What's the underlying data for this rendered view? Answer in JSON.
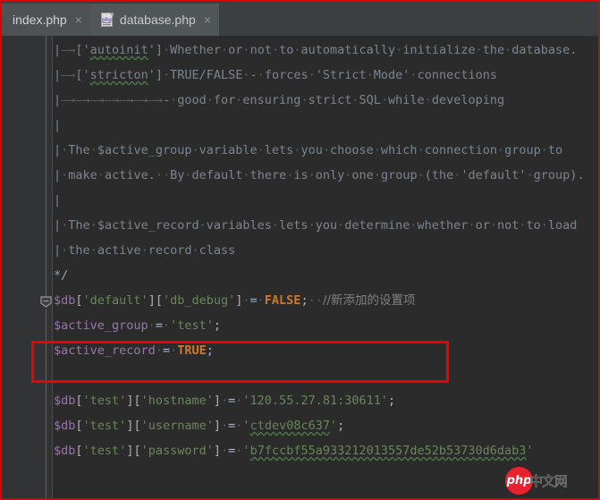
{
  "window": {
    "annotation_box_color": "#f00000"
  },
  "tabs": [
    {
      "label": "index.php",
      "active": false,
      "close": "×",
      "icon": "php-file-icon"
    },
    {
      "label": "database.php",
      "active": true,
      "close": "×",
      "icon": "php-file-icon"
    }
  ],
  "editor": {
    "theme_background": "#2b2b2b",
    "gutter_background": "#313335",
    "fold_marker": "collapse-comment-block",
    "lines": [
      {
        "id": "l1",
        "tokens": [
          {
            "t": "|",
            "c": "cmt"
          },
          {
            "t": "—→",
            "c": "arrow"
          },
          {
            "t": "['",
            "c": "cmt"
          },
          {
            "t": "autoinit",
            "c": "cmt spell"
          },
          {
            "t": "']",
            "c": "cmt"
          },
          {
            "t": "·",
            "c": "ws"
          },
          {
            "t": "Whether",
            "c": "cmt"
          },
          {
            "t": "·",
            "c": "ws"
          },
          {
            "t": "or",
            "c": "cmt"
          },
          {
            "t": "·",
            "c": "ws"
          },
          {
            "t": "not",
            "c": "cmt"
          },
          {
            "t": "·",
            "c": "ws"
          },
          {
            "t": "to",
            "c": "cmt"
          },
          {
            "t": "·",
            "c": "ws"
          },
          {
            "t": "automatically",
            "c": "cmt"
          },
          {
            "t": "·",
            "c": "ws"
          },
          {
            "t": "initialize",
            "c": "cmt"
          },
          {
            "t": "·",
            "c": "ws"
          },
          {
            "t": "the",
            "c": "cmt"
          },
          {
            "t": "·",
            "c": "ws"
          },
          {
            "t": "database.",
            "c": "cmt"
          }
        ]
      },
      {
        "id": "l2",
        "tokens": [
          {
            "t": "|",
            "c": "cmt"
          },
          {
            "t": "—→",
            "c": "arrow"
          },
          {
            "t": "['",
            "c": "cmt"
          },
          {
            "t": "stricton",
            "c": "cmt spell"
          },
          {
            "t": "']",
            "c": "cmt"
          },
          {
            "t": "·",
            "c": "ws"
          },
          {
            "t": "TRUE/FALSE",
            "c": "cmt"
          },
          {
            "t": "·",
            "c": "ws"
          },
          {
            "t": "-",
            "c": "cmt"
          },
          {
            "t": "·",
            "c": "ws"
          },
          {
            "t": "forces",
            "c": "cmt"
          },
          {
            "t": "·",
            "c": "ws"
          },
          {
            "t": "'Strict",
            "c": "cmt"
          },
          {
            "t": "·",
            "c": "ws"
          },
          {
            "t": "Mode'",
            "c": "cmt"
          },
          {
            "t": "·",
            "c": "ws"
          },
          {
            "t": "connections",
            "c": "cmt"
          }
        ]
      },
      {
        "id": "l3",
        "tokens": [
          {
            "t": "|",
            "c": "cmt"
          },
          {
            "t": "—→—→—→—→—→—→—→",
            "c": "arrow"
          },
          {
            "t": "-",
            "c": "cmt"
          },
          {
            "t": "·",
            "c": "ws"
          },
          {
            "t": "good",
            "c": "cmt"
          },
          {
            "t": "·",
            "c": "ws"
          },
          {
            "t": "for",
            "c": "cmt"
          },
          {
            "t": "·",
            "c": "ws"
          },
          {
            "t": "ensuring",
            "c": "cmt"
          },
          {
            "t": "·",
            "c": "ws"
          },
          {
            "t": "strict",
            "c": "cmt"
          },
          {
            "t": "·",
            "c": "ws"
          },
          {
            "t": "SQL",
            "c": "cmt"
          },
          {
            "t": "·",
            "c": "ws"
          },
          {
            "t": "while",
            "c": "cmt"
          },
          {
            "t": "·",
            "c": "ws"
          },
          {
            "t": "developing",
            "c": "cmt"
          }
        ]
      },
      {
        "id": "l4",
        "tokens": [
          {
            "t": "|",
            "c": "cmt"
          }
        ]
      },
      {
        "id": "l5",
        "tokens": [
          {
            "t": "|",
            "c": "cmt"
          },
          {
            "t": "·",
            "c": "ws"
          },
          {
            "t": "The",
            "c": "cmt"
          },
          {
            "t": "·",
            "c": "ws"
          },
          {
            "t": "$active_group",
            "c": "cmt"
          },
          {
            "t": "·",
            "c": "ws"
          },
          {
            "t": "variable",
            "c": "cmt"
          },
          {
            "t": "·",
            "c": "ws"
          },
          {
            "t": "lets",
            "c": "cmt"
          },
          {
            "t": "·",
            "c": "ws"
          },
          {
            "t": "you",
            "c": "cmt"
          },
          {
            "t": "·",
            "c": "ws"
          },
          {
            "t": "choose",
            "c": "cmt"
          },
          {
            "t": "·",
            "c": "ws"
          },
          {
            "t": "which",
            "c": "cmt"
          },
          {
            "t": "·",
            "c": "ws"
          },
          {
            "t": "connection",
            "c": "cmt"
          },
          {
            "t": "·",
            "c": "ws"
          },
          {
            "t": "group",
            "c": "cmt"
          },
          {
            "t": "·",
            "c": "ws"
          },
          {
            "t": "to",
            "c": "cmt"
          }
        ]
      },
      {
        "id": "l6",
        "tokens": [
          {
            "t": "|",
            "c": "cmt"
          },
          {
            "t": "·",
            "c": "ws"
          },
          {
            "t": "make",
            "c": "cmt"
          },
          {
            "t": "·",
            "c": "ws"
          },
          {
            "t": "active.",
            "c": "cmt"
          },
          {
            "t": "··",
            "c": "ws"
          },
          {
            "t": "By",
            "c": "cmt"
          },
          {
            "t": "·",
            "c": "ws"
          },
          {
            "t": "default",
            "c": "cmt"
          },
          {
            "t": "·",
            "c": "ws"
          },
          {
            "t": "there",
            "c": "cmt"
          },
          {
            "t": "·",
            "c": "ws"
          },
          {
            "t": "is",
            "c": "cmt"
          },
          {
            "t": "·",
            "c": "ws"
          },
          {
            "t": "only",
            "c": "cmt"
          },
          {
            "t": "·",
            "c": "ws"
          },
          {
            "t": "one",
            "c": "cmt"
          },
          {
            "t": "·",
            "c": "ws"
          },
          {
            "t": "group",
            "c": "cmt"
          },
          {
            "t": "·",
            "c": "ws"
          },
          {
            "t": "(the",
            "c": "cmt"
          },
          {
            "t": "·",
            "c": "ws"
          },
          {
            "t": "'default'",
            "c": "cmt"
          },
          {
            "t": "·",
            "c": "ws"
          },
          {
            "t": "group).",
            "c": "cmt"
          }
        ]
      },
      {
        "id": "l7",
        "tokens": [
          {
            "t": "|",
            "c": "cmt"
          }
        ]
      },
      {
        "id": "l8",
        "tokens": [
          {
            "t": "|",
            "c": "cmt"
          },
          {
            "t": "·",
            "c": "ws"
          },
          {
            "t": "The",
            "c": "cmt"
          },
          {
            "t": "·",
            "c": "ws"
          },
          {
            "t": "$active_record",
            "c": "cmt"
          },
          {
            "t": "·",
            "c": "ws"
          },
          {
            "t": "variables",
            "c": "cmt"
          },
          {
            "t": "·",
            "c": "ws"
          },
          {
            "t": "lets",
            "c": "cmt"
          },
          {
            "t": "·",
            "c": "ws"
          },
          {
            "t": "you",
            "c": "cmt"
          },
          {
            "t": "·",
            "c": "ws"
          },
          {
            "t": "determine",
            "c": "cmt"
          },
          {
            "t": "·",
            "c": "ws"
          },
          {
            "t": "whether",
            "c": "cmt"
          },
          {
            "t": "·",
            "c": "ws"
          },
          {
            "t": "or",
            "c": "cmt"
          },
          {
            "t": "·",
            "c": "ws"
          },
          {
            "t": "not",
            "c": "cmt"
          },
          {
            "t": "·",
            "c": "ws"
          },
          {
            "t": "to",
            "c": "cmt"
          },
          {
            "t": "·",
            "c": "ws"
          },
          {
            "t": "load",
            "c": "cmt"
          }
        ]
      },
      {
        "id": "l9",
        "tokens": [
          {
            "t": "|",
            "c": "cmt"
          },
          {
            "t": "·",
            "c": "ws"
          },
          {
            "t": "the",
            "c": "cmt"
          },
          {
            "t": "·",
            "c": "ws"
          },
          {
            "t": "active",
            "c": "cmt"
          },
          {
            "t": "·",
            "c": "ws"
          },
          {
            "t": "record",
            "c": "cmt"
          },
          {
            "t": "·",
            "c": "ws"
          },
          {
            "t": "class",
            "c": "cmt"
          }
        ]
      },
      {
        "id": "l10",
        "tokens": [
          {
            "t": "*/",
            "c": "cmt-b"
          }
        ]
      },
      {
        "id": "l11",
        "tokens": [
          {
            "t": "$db",
            "c": "var"
          },
          {
            "t": "[",
            "c": "brk"
          },
          {
            "t": "'default'",
            "c": "str"
          },
          {
            "t": "][",
            "c": "brk"
          },
          {
            "t": "'db_debug'",
            "c": "str"
          },
          {
            "t": "]",
            "c": "brk"
          },
          {
            "t": "·",
            "c": "ws"
          },
          {
            "t": "=",
            "c": "op"
          },
          {
            "t": "·",
            "c": "ws"
          },
          {
            "t": "FALSE",
            "c": "kw"
          },
          {
            "t": ";",
            "c": "op"
          },
          {
            "t": "··",
            "c": "ws"
          },
          {
            "t": "//新添加的设置项",
            "c": "zh"
          }
        ]
      },
      {
        "id": "l12",
        "tokens": [
          {
            "t": "$active_group",
            "c": "var"
          },
          {
            "t": "·",
            "c": "ws"
          },
          {
            "t": "=",
            "c": "op"
          },
          {
            "t": "·",
            "c": "ws"
          },
          {
            "t": "'test'",
            "c": "str"
          },
          {
            "t": ";",
            "c": "op"
          }
        ]
      },
      {
        "id": "l13",
        "tokens": [
          {
            "t": "$active_record",
            "c": "var"
          },
          {
            "t": "·",
            "c": "ws"
          },
          {
            "t": "=",
            "c": "op"
          },
          {
            "t": "·",
            "c": "ws"
          },
          {
            "t": "TRUE",
            "c": "kw"
          },
          {
            "t": ";",
            "c": "op"
          }
        ]
      },
      {
        "id": "l14",
        "tokens": []
      },
      {
        "id": "l15",
        "tokens": [
          {
            "t": "$db",
            "c": "var"
          },
          {
            "t": "[",
            "c": "brk"
          },
          {
            "t": "'test'",
            "c": "str"
          },
          {
            "t": "][",
            "c": "brk"
          },
          {
            "t": "'hostname'",
            "c": "str"
          },
          {
            "t": "]",
            "c": "brk"
          },
          {
            "t": "·",
            "c": "ws"
          },
          {
            "t": "=",
            "c": "op"
          },
          {
            "t": "·",
            "c": "ws"
          },
          {
            "t": "'120.55.27.81:30611'",
            "c": "str"
          },
          {
            "t": ";",
            "c": "op"
          }
        ]
      },
      {
        "id": "l16",
        "tokens": [
          {
            "t": "$db",
            "c": "var"
          },
          {
            "t": "[",
            "c": "brk"
          },
          {
            "t": "'test'",
            "c": "str"
          },
          {
            "t": "][",
            "c": "brk"
          },
          {
            "t": "'username'",
            "c": "str"
          },
          {
            "t": "]",
            "c": "brk"
          },
          {
            "t": "·",
            "c": "ws"
          },
          {
            "t": "=",
            "c": "op"
          },
          {
            "t": "·",
            "c": "ws"
          },
          {
            "t": "'",
            "c": "str"
          },
          {
            "t": "ctdev08c637",
            "c": "str spell"
          },
          {
            "t": "'",
            "c": "str"
          },
          {
            "t": ";",
            "c": "op"
          }
        ]
      },
      {
        "id": "l17",
        "tokens": [
          {
            "t": "$db",
            "c": "var"
          },
          {
            "t": "[",
            "c": "brk"
          },
          {
            "t": "'test'",
            "c": "str"
          },
          {
            "t": "][",
            "c": "brk"
          },
          {
            "t": "'password'",
            "c": "str"
          },
          {
            "t": "]",
            "c": "brk"
          },
          {
            "t": "·",
            "c": "ws"
          },
          {
            "t": "=",
            "c": "op"
          },
          {
            "t": "·",
            "c": "ws"
          },
          {
            "t": "'",
            "c": "str"
          },
          {
            "t": "b7fccbf55a933212013557de52b53730d6dab3",
            "c": "str spell"
          },
          {
            "t": "'",
            "c": "str"
          }
        ]
      }
    ]
  },
  "watermark": {
    "logo_text": "php",
    "site_text": "中文网"
  }
}
